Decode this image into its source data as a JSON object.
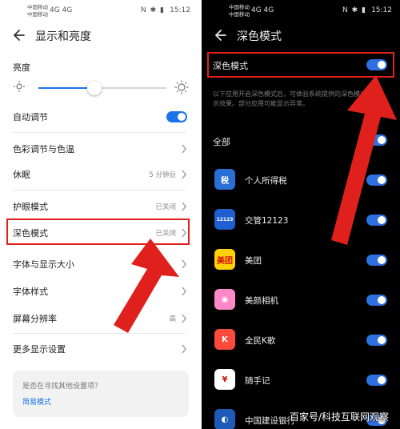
{
  "left": {
    "status": {
      "carrier1": "中国移动",
      "carrier2": "中国移动",
      "sig": "4G 4G",
      "icons": "N ✱ ▮",
      "time": "15:12"
    },
    "title": "显示和亮度",
    "brightness_label": "亮度",
    "brightness_level": 0.44,
    "auto_adjust": {
      "label": "自动调节",
      "on": true
    },
    "items": [
      {
        "label": "色彩调节与色温",
        "value": ""
      },
      {
        "label": "休眠",
        "value": "5 分钟后"
      },
      {
        "label": "护眼模式",
        "value": "已关闭"
      },
      {
        "label": "深色模式",
        "value": "已关闭"
      },
      {
        "label": "字体与显示大小",
        "value": ""
      },
      {
        "label": "字体样式",
        "value": ""
      },
      {
        "label": "屏幕分辨率",
        "value": "高"
      },
      {
        "label": "更多显示设置",
        "value": ""
      }
    ],
    "hint": {
      "question": "是否在寻找其他设置项？",
      "link": "简易模式"
    }
  },
  "right": {
    "status": {
      "carrier1": "中国移动",
      "carrier2": "中国移动",
      "sig": "4G 4G",
      "icons": "N ✱ ▮",
      "time": "15:12"
    },
    "title": "深色模式",
    "dark_mode": {
      "label": "深色模式",
      "on": true
    },
    "description": "以下应用开启深色模式后，可体验系统提供的深色模式显示效果。部分应用可能显示异常。",
    "all": {
      "label": "全部",
      "on": true
    },
    "apps": [
      {
        "name": "个人所得税",
        "icon": "tax-app-icon",
        "color": "#2a6fd6",
        "glyph": "税",
        "on": true
      },
      {
        "name": "交管12123",
        "icon": "traffic-app-icon",
        "color": "#1f5fd0",
        "glyph": "12123",
        "on": true
      },
      {
        "name": "美团",
        "icon": "meituan-app-icon",
        "color": "#ffd100",
        "glyph": "美团",
        "on": true
      },
      {
        "name": "美颜相机",
        "icon": "beauty-camera-icon",
        "color": "#ff88c8",
        "glyph": "◉",
        "on": true
      },
      {
        "name": "全民K歌",
        "icon": "karaoke-app-icon",
        "color": "#ff4a3c",
        "glyph": "K",
        "on": true
      },
      {
        "name": "随手记",
        "icon": "notes-app-icon",
        "color": "#ffffff",
        "glyph": "¥",
        "on": true
      },
      {
        "name": "中国建设银行",
        "icon": "ccb-app-icon",
        "color": "#1e5bb8",
        "glyph": "◐",
        "on": true
      }
    ]
  },
  "watermark": "百家号/科技互联网观察",
  "colors": {
    "accent": "#1a73e8",
    "highlight": "#e0201c"
  }
}
